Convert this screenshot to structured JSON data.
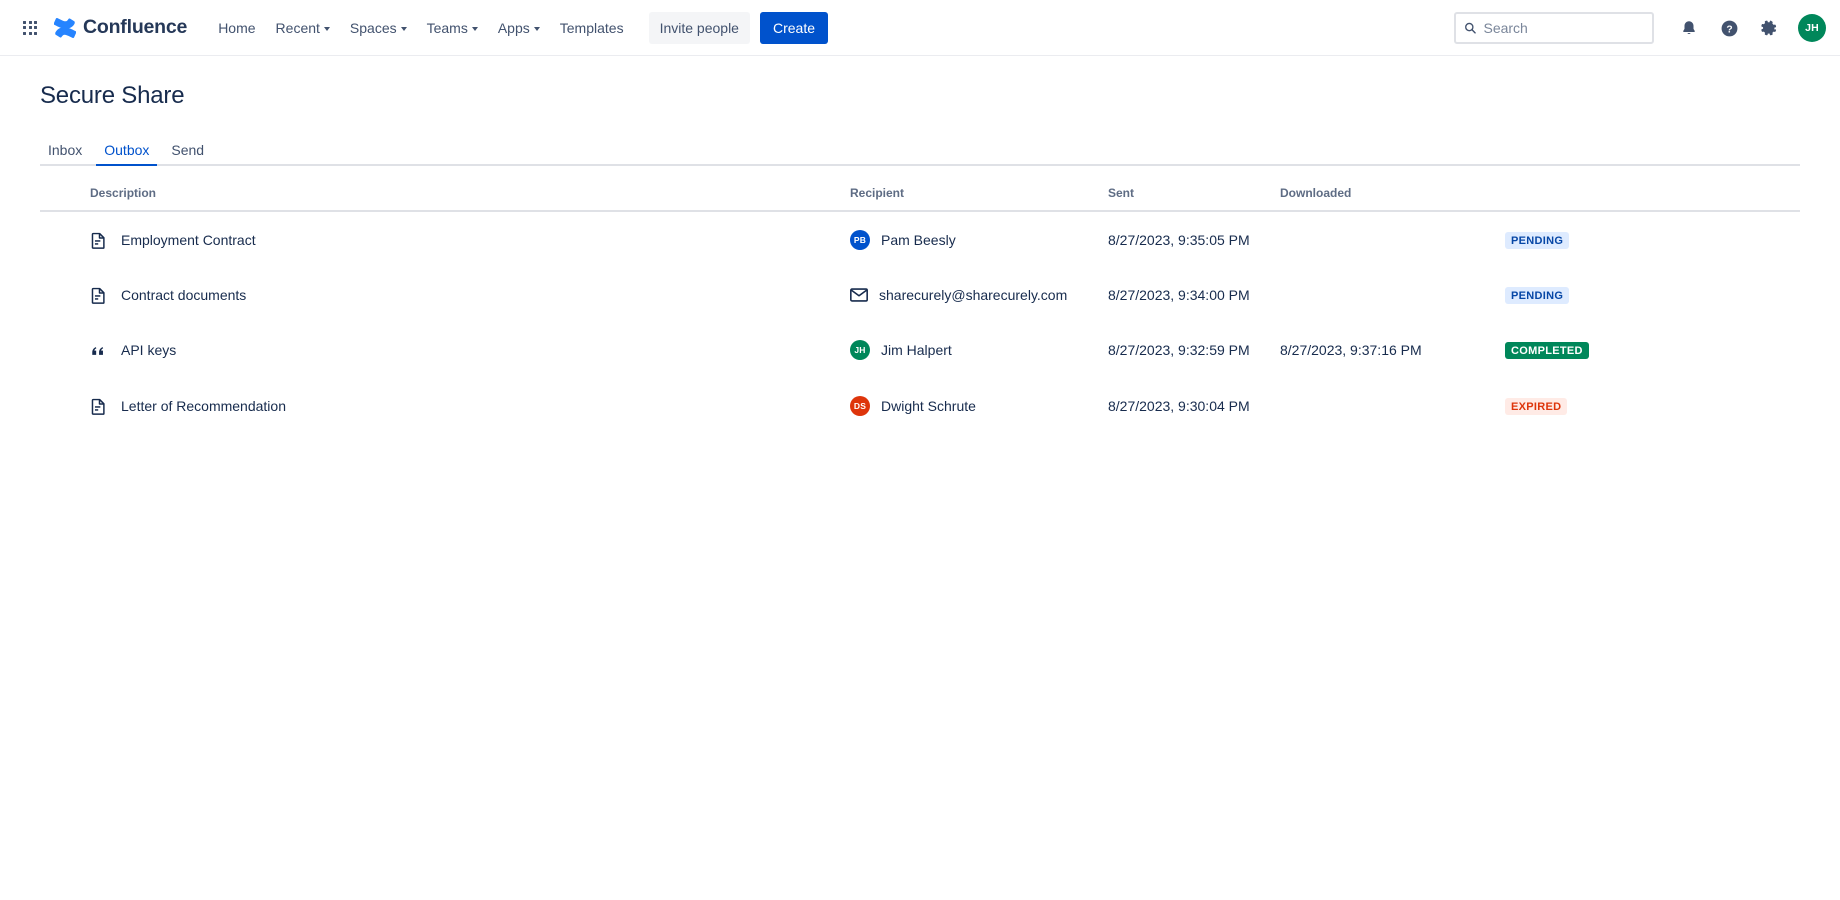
{
  "topnav": {
    "app_switcher_icon": "grid-apps-icon",
    "brand": {
      "logo_icon": "confluence-logo-icon",
      "label": "Confluence"
    },
    "items": [
      {
        "label": "Home",
        "has_caret": false
      },
      {
        "label": "Recent",
        "has_caret": true
      },
      {
        "label": "Spaces",
        "has_caret": true
      },
      {
        "label": "Teams",
        "has_caret": true
      },
      {
        "label": "Apps",
        "has_caret": true
      },
      {
        "label": "Templates",
        "has_caret": false
      }
    ],
    "invite_label": "Invite people",
    "create_label": "Create",
    "search": {
      "placeholder": "Search",
      "value": "",
      "icon": "search-icon"
    },
    "notification_icon": "bell-icon",
    "help_icon": "help-circle-icon",
    "settings_icon": "gear-icon",
    "avatar": {
      "initials": "JH",
      "color": "#00875A"
    }
  },
  "page": {
    "title": "Secure Share",
    "tabs": [
      {
        "label": "Inbox",
        "active": false
      },
      {
        "label": "Outbox",
        "active": true
      },
      {
        "label": "Send",
        "active": false
      }
    ]
  },
  "table": {
    "columns": [
      "Description",
      "Recipient",
      "Sent",
      "Downloaded",
      ""
    ],
    "rows": [
      {
        "icon": "document-icon",
        "description": "Employment Contract",
        "recipient": {
          "type": "user",
          "name": "Pam Beesly",
          "initials": "PB",
          "color": "#0052CC"
        },
        "sent": "8/27/2023, 9:35:05 PM",
        "downloaded": "",
        "status": {
          "label": "PENDING",
          "variant": "pending"
        }
      },
      {
        "icon": "document-icon",
        "description": "Contract documents",
        "recipient": {
          "type": "email",
          "name": "sharecurely@sharecurely.com",
          "initials": "",
          "color": ""
        },
        "sent": "8/27/2023, 9:34:00 PM",
        "downloaded": "",
        "status": {
          "label": "PENDING",
          "variant": "pending"
        }
      },
      {
        "icon": "quote-icon",
        "description": "API keys",
        "recipient": {
          "type": "user",
          "name": "Jim Halpert",
          "initials": "JH",
          "color": "#00875A"
        },
        "sent": "8/27/2023, 9:32:59 PM",
        "downloaded": "8/27/2023, 9:37:16 PM",
        "status": {
          "label": "COMPLETED",
          "variant": "completed"
        }
      },
      {
        "icon": "document-icon",
        "description": "Letter of Recommendation",
        "recipient": {
          "type": "user",
          "name": "Dwight Schrute",
          "initials": "DS",
          "color": "#DE350B"
        },
        "sent": "8/27/2023, 9:30:04 PM",
        "downloaded": "",
        "status": {
          "label": "EXPIRED",
          "variant": "expired"
        }
      }
    ]
  },
  "colors": {
    "brand_blue": "#0052CC",
    "text": "#172B4D",
    "subtle_text": "#5E6C84",
    "border": "#DFE1E6",
    "green": "#00875A",
    "red": "#DE350B"
  }
}
